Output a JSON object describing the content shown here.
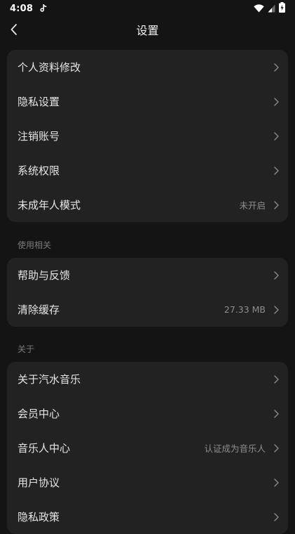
{
  "status_bar": {
    "time": "4:08"
  },
  "nav": {
    "title": "设置"
  },
  "group_account": {
    "items": [
      {
        "label": "个人资料修改",
        "value": ""
      },
      {
        "label": "隐私设置",
        "value": ""
      },
      {
        "label": "注销账号",
        "value": ""
      },
      {
        "label": "系统权限",
        "value": ""
      },
      {
        "label": "未成年人模式",
        "value": "未开启"
      }
    ]
  },
  "group_usage": {
    "header": "使用相关",
    "items": [
      {
        "label": "帮助与反馈",
        "value": ""
      },
      {
        "label": "清除缓存",
        "value": "27.33 MB"
      }
    ]
  },
  "group_about": {
    "header": "关于",
    "items": [
      {
        "label": "关于汽水音乐",
        "value": ""
      },
      {
        "label": "会员中心",
        "value": ""
      },
      {
        "label": "音乐人中心",
        "value": "认证成为音乐人"
      },
      {
        "label": "用户协议",
        "value": ""
      },
      {
        "label": "隐私政策",
        "value": ""
      }
    ]
  },
  "icons": {
    "back": "back-arrow-icon",
    "row_arrow": "chevron-right-icon",
    "status_app": "tiktok-notification-icon",
    "wifi": "wifi-icon",
    "signal": "signal-icon",
    "battery": "battery-charging-icon"
  },
  "colors": {
    "background": "#141414",
    "card": "#222222",
    "text_primary": "#e6e6e6",
    "text_secondary": "#8d8d8d"
  }
}
